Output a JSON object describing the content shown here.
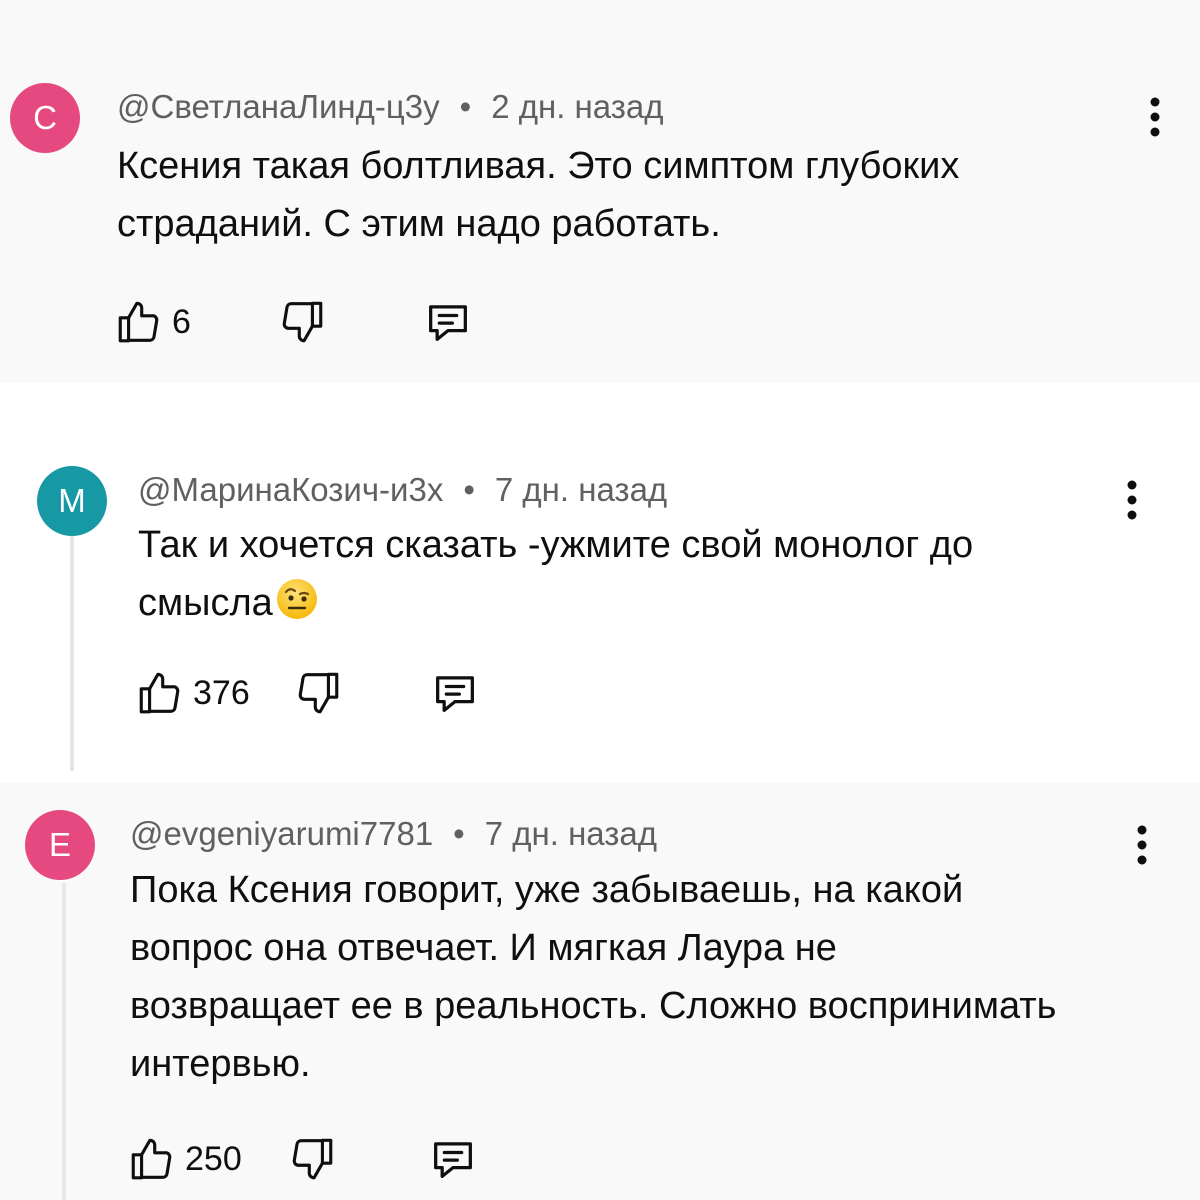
{
  "comments": [
    {
      "avatar_letter": "С",
      "avatar_color": "#e64980",
      "author": "@СветланаЛинд-ц3у",
      "separator": "•",
      "time": "2 дн. назад",
      "text_lines": [
        "Ксения такая болтливая. Это симптом глубоких",
        "страданий. С этим надо работать."
      ],
      "likes": "6"
    },
    {
      "avatar_letter": "М",
      "avatar_color": "#1799a5",
      "author": "@МаринаКозич-и3х",
      "separator": "•",
      "time": "7 дн. назад",
      "text_lines": [
        "Так и хочется сказать -ужмите свой монолог до",
        "смысла"
      ],
      "likes": "376"
    },
    {
      "avatar_letter": "Е",
      "avatar_color": "#e64980",
      "author": "@evgeniyarumi7781",
      "separator": "•",
      "time": "7 дн. назад",
      "text_lines": [
        "Пока Ксения говорит, уже забываешь, на какой",
        "вопрос она отвечает. И мягкая Лаура не",
        "возвращает ее в реальность. Сложно воспринимать",
        "интервью."
      ],
      "likes": "250"
    }
  ],
  "icons": {
    "like": "thumbs-up-icon",
    "dislike": "thumbs-down-icon",
    "reply": "reply-comment-icon",
    "menu": "more-vertical-icon",
    "emoji": "face-with-raised-eyebrow-emoji"
  }
}
